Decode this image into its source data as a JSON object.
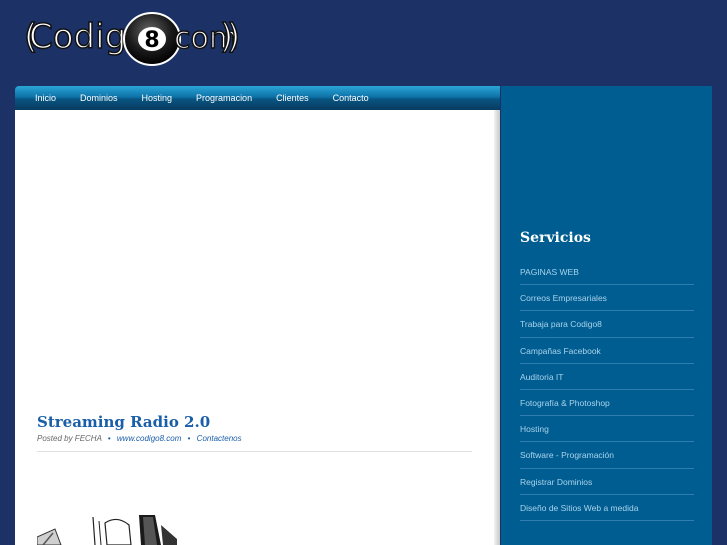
{
  "logo": {
    "text_left": "Codig",
    "digit": "8",
    "text_right": "com"
  },
  "nav": {
    "items": [
      "Inicio",
      "Dominios",
      "Hosting",
      "Programacion",
      "Clientes",
      "Contacto"
    ]
  },
  "post": {
    "title": "Streaming Radio 2.0",
    "meta_posted": "Posted by FECHA",
    "meta_site": "www.codigo8.com",
    "meta_contact": "Contactenos",
    "meta_separator": "•"
  },
  "sidebar": {
    "title": "Servicios",
    "items": [
      "PAGINAS WEB",
      "Correos Empresariales",
      "Trabaja para Codigo8",
      "Campañas Facebook",
      "Auditoria IT",
      "Fotografía & Photoshop",
      "Hosting",
      "Software - Programación",
      "Registrar Dominios",
      "Diseño de Sitios Web a medida"
    ]
  },
  "colors": {
    "background": "#1c3166",
    "sidebar": "#005d91",
    "link_blue": "#1a5ea8",
    "sidebar_link": "#a9d3ec"
  }
}
